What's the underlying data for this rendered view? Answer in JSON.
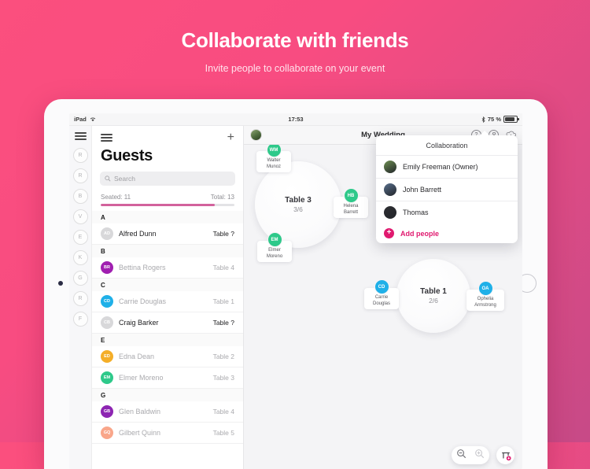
{
  "promo": {
    "title": "Collaborate with friends",
    "subtitle": "Invite people to collaborate on your event"
  },
  "statusbar": {
    "device": "iPad",
    "wifi_icon": "wifi-icon",
    "time": "17:53",
    "bluetooth_icon": "bluetooth-icon",
    "battery": "75 %"
  },
  "rail": {
    "menu_icon": "hamburger-menu-icon",
    "items": [
      {
        "label": "R"
      },
      {
        "label": "R"
      },
      {
        "label": "B"
      },
      {
        "label": "V"
      },
      {
        "label": "E"
      },
      {
        "label": "K"
      },
      {
        "label": "G"
      },
      {
        "label": "R"
      },
      {
        "label": "F"
      }
    ]
  },
  "guests": {
    "menu_icon": "hamburger-menu-icon",
    "add_label": "+",
    "title": "Guests",
    "search": {
      "icon": "search-icon",
      "placeholder": "Search",
      "value": ""
    },
    "seated_label": "Seated: 11",
    "total_label": "Total: 13",
    "progress_percent": 85,
    "sections": [
      {
        "letter": "A",
        "rows": [
          {
            "initials": "AD",
            "color": "#d8d8da",
            "name": "Alfred Dunn",
            "table": "Table ?",
            "seated": false
          }
        ]
      },
      {
        "letter": "B",
        "rows": [
          {
            "initials": "BR",
            "color": "#a01fb0",
            "name": "Bettina Rogers",
            "table": "Table 4",
            "seated": true
          }
        ]
      },
      {
        "letter": "C",
        "rows": [
          {
            "initials": "CD",
            "color": "#1fb0e8",
            "name": "Carrie Douglas",
            "table": "Table 1",
            "seated": true
          },
          {
            "initials": "CB",
            "color": "#d8d8da",
            "name": "Craig Barker",
            "table": "Table ?",
            "seated": false
          }
        ]
      },
      {
        "letter": "E",
        "rows": [
          {
            "initials": "ED",
            "color": "#f4ae28",
            "name": "Edna Dean",
            "table": "Table 2",
            "seated": true
          },
          {
            "initials": "EM",
            "color": "#2ec98a",
            "name": "Elmer Moreno",
            "table": "Table 3",
            "seated": true
          }
        ]
      },
      {
        "letter": "G",
        "rows": [
          {
            "initials": "GB",
            "color": "#8d25b2",
            "name": "Glen Baldwin",
            "table": "Table 4",
            "seated": true
          },
          {
            "initials": "GQ",
            "color": "#f9a68a",
            "name": "Gilbert Quinn",
            "table": "Table 5",
            "seated": true
          }
        ]
      }
    ]
  },
  "navbar": {
    "avatar": "user-avatar",
    "title": "My Wedding",
    "help_icon": "help-icon",
    "help_glyph": "?",
    "collaboration_icon": "collaboration-icon",
    "download_icon": "cloud-download-icon",
    "badge_color": "#e6197c"
  },
  "popover": {
    "title": "Collaboration",
    "people": [
      {
        "name": "Emily Freeman (Owner)",
        "avatar_color": "#6f8f52"
      },
      {
        "name": "John Barrett",
        "avatar_color": "#59708c"
      },
      {
        "name": "Thomas",
        "avatar_color": "#2e2e32"
      }
    ],
    "add_people": {
      "icon": "plus-circle-icon",
      "glyph": "+",
      "label": "Add people"
    }
  },
  "canvas": {
    "tables": [
      {
        "name": "Table 3",
        "capacity": "3/6"
      },
      {
        "name": "Table 1",
        "capacity": "2/6"
      }
    ],
    "seats": [
      {
        "initials": "WM",
        "name": "Walter\nMunoz",
        "name_line1": "Walter",
        "name_line2": "Munoz",
        "color": "#2ec98a"
      },
      {
        "initials": "HB",
        "name_line1": "Helena",
        "name_line2": "Barrett",
        "color": "#2ec98a"
      },
      {
        "initials": "EM",
        "name_line1": "Elmer",
        "name_line2": "Moreno",
        "color": "#2ec98a"
      },
      {
        "initials": "CD",
        "name_line1": "Carrie",
        "name_line2": "Douglas",
        "color": "#1fb0e8"
      },
      {
        "initials": "OA",
        "name_line1": "Ophelia",
        "name_line2": "Armstrong",
        "color": "#1fb0e8"
      }
    ]
  },
  "toolbar": {
    "zoom_out_icon": "zoom-out-icon",
    "zoom_in_icon": "zoom-in-icon",
    "add_table_icon": "add-table-icon"
  }
}
